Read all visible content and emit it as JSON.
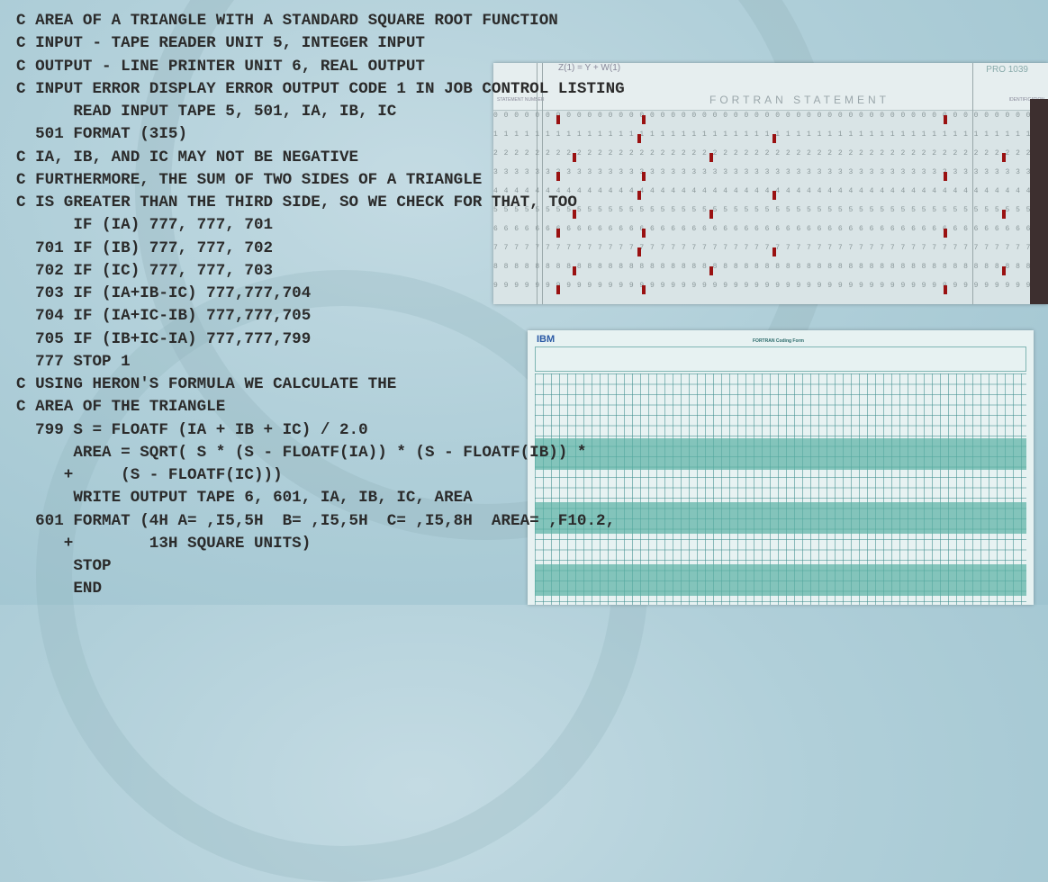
{
  "code_lines": [
    "C AREA OF A TRIANGLE WITH A STANDARD SQUARE ROOT FUNCTION",
    "C INPUT - TAPE READER UNIT 5, INTEGER INPUT",
    "C OUTPUT - LINE PRINTER UNIT 6, REAL OUTPUT",
    "C INPUT ERROR DISPLAY ERROR OUTPUT CODE 1 IN JOB CONTROL LISTING",
    "      READ INPUT TAPE 5, 501, IA, IB, IC",
    "  501 FORMAT (3I5)",
    "C IA, IB, AND IC MAY NOT BE NEGATIVE",
    "C FURTHERMORE, THE SUM OF TWO SIDES OF A TRIANGLE",
    "C IS GREATER THAN THE THIRD SIDE, SO WE CHECK FOR THAT, TOO",
    "      IF (IA) 777, 777, 701",
    "  701 IF (IB) 777, 777, 702",
    "  702 IF (IC) 777, 777, 703",
    "  703 IF (IA+IB-IC) 777,777,704",
    "  704 IF (IA+IC-IB) 777,777,705",
    "  705 IF (IB+IC-IA) 777,777,799",
    "  777 STOP 1",
    "C USING HERON'S FORMULA WE CALCULATE THE",
    "C AREA OF THE TRIANGLE",
    "  799 S = FLOATF (IA + IB + IC) / 2.0",
    "      AREA = SQRT( S * (S - FLOATF(IA)) * (S - FLOATF(IB)) *",
    "     +     (S - FLOATF(IC)))",
    "      WRITE OUTPUT TAPE 6, 601, IA, IB, IC, AREA",
    "  601 FORMAT (4H A= ,I5,5H  B= ,I5,5H  C= ,I5,8H  AREA= ,F10.2,",
    "     +        13H SQUARE UNITS)",
    "      STOP",
    "      END"
  ],
  "card": {
    "top_label": "Z(1) = Y + W(1)",
    "statement_label": "FORTRAN   STATEMENT",
    "program_label": "PRO 1039",
    "statement_number_label": "STATEMENT NUMBER",
    "ident_label": "IDENTIFICATION",
    "row_digits": [
      "0",
      "1",
      "2",
      "3",
      "4",
      "5",
      "6",
      "7",
      "8",
      "9"
    ]
  },
  "coding_form": {
    "logo": "IBM",
    "title": "FORTRAN Coding Form"
  }
}
